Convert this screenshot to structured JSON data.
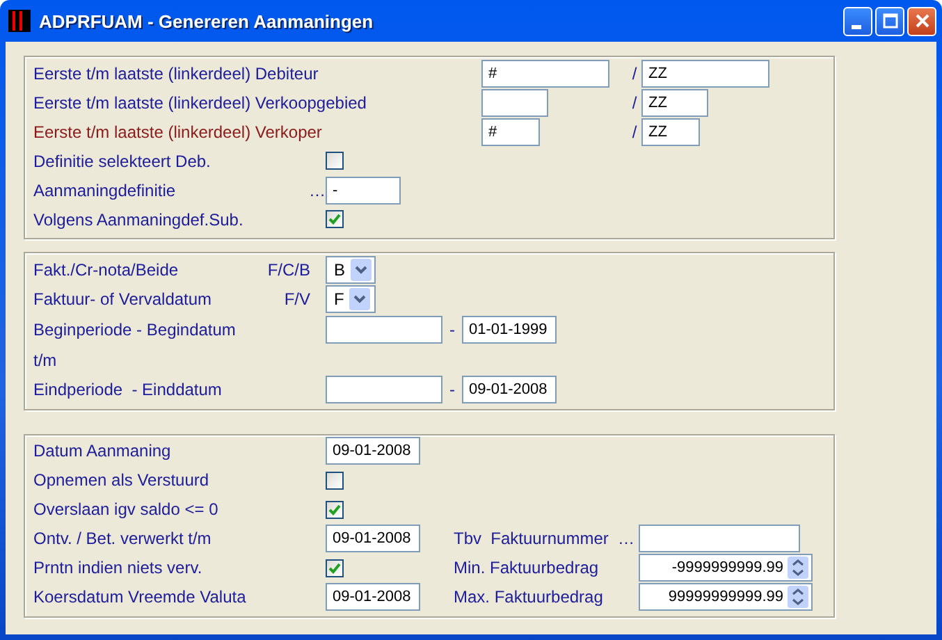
{
  "window": {
    "title": "ADPRFUAM - Genereren Aanmaningen"
  },
  "sections": [
    {
      "rows": [
        {
          "kind": "range",
          "label": "Eerste t/m laatste (linkerdeel) Debiteur",
          "color": "#1c1c9c",
          "from": "#",
          "separator": "/",
          "to": "ZZ"
        },
        {
          "kind": "range",
          "label": "Eerste t/m laatste (linkerdeel) Verkoopgebied",
          "color": "#1c1c9c",
          "separator": "/",
          "to": "ZZ"
        },
        {
          "kind": "range",
          "label": "Eerste t/m laatste (linkerdeel) Verkoper",
          "color": "#8b1a1a",
          "from": "#",
          "separator": "/",
          "to": "ZZ"
        },
        {
          "kind": "checkbox",
          "label": "Definitie selekteert Deb.",
          "color": "#1c1c9c",
          "checked": false
        },
        {
          "kind": "lookup",
          "label": "Aanmaningdefinitie",
          "color": "#1c1c9c",
          "prefix": "…",
          "value": "-"
        },
        {
          "kind": "checkbox",
          "label": "Volgens Aanmaningdef.Sub.",
          "color": "#1c1c9c",
          "checked": true
        }
      ]
    },
    {
      "rows": [
        {
          "kind": "select",
          "label": "Fakt./Cr-nota/Beide",
          "color": "#1c1c9c",
          "hint": "F/C/B",
          "value": "B"
        },
        {
          "kind": "select",
          "label": "Faktuur- of Vervaldatum",
          "color": "#1c1c9c",
          "hint": "F/V",
          "value": "F"
        },
        {
          "kind": "date-range",
          "label": "Beginperiode - Begindatum",
          "color": "#1c1c9c",
          "separator": "-",
          "to": "01-01-1999"
        },
        {
          "kind": "text",
          "label": "t/m",
          "color": "#1c1c9c"
        },
        {
          "kind": "date-range",
          "label": "Eindperiode  - Einddatum",
          "color": "#1c1c9c",
          "separator": "-",
          "to": "09-01-2008"
        }
      ]
    },
    {
      "rows": [
        {
          "kind": "date",
          "label": "Datum Aanmaning",
          "color": "#1c1c9c",
          "value": "09-01-2008"
        },
        {
          "kind": "checkbox",
          "label": "Opnemen als Verstuurd",
          "color": "#1c1c9c",
          "checked": false
        },
        {
          "kind": "checkbox",
          "label": "Overslaan igv saldo <= 0",
          "color": "#1c1c9c",
          "checked": true
        },
        {
          "kind": "date",
          "label": "Ontv. / Bet. verwerkt t/m",
          "color": "#1c1c9c",
          "value": "09-01-2008",
          "side": {
            "kind": "lookup",
            "label": "Tbv  Faktuurnummer",
            "prefix": "…"
          }
        },
        {
          "kind": "checkbox",
          "label": "Prntn indien niets verv.",
          "color": "#1c1c9c",
          "checked": true,
          "side": {
            "kind": "spinner",
            "label": "Min. Faktuurbedrag",
            "value": "-9999999999.99"
          }
        },
        {
          "kind": "date",
          "label": "Koersdatum Vreemde Valuta",
          "color": "#1c1c9c",
          "value": "09-01-2008",
          "side": {
            "kind": "spinner",
            "label": "Max. Faktuurbedrag",
            "value": "99999999999.99"
          }
        }
      ]
    }
  ]
}
